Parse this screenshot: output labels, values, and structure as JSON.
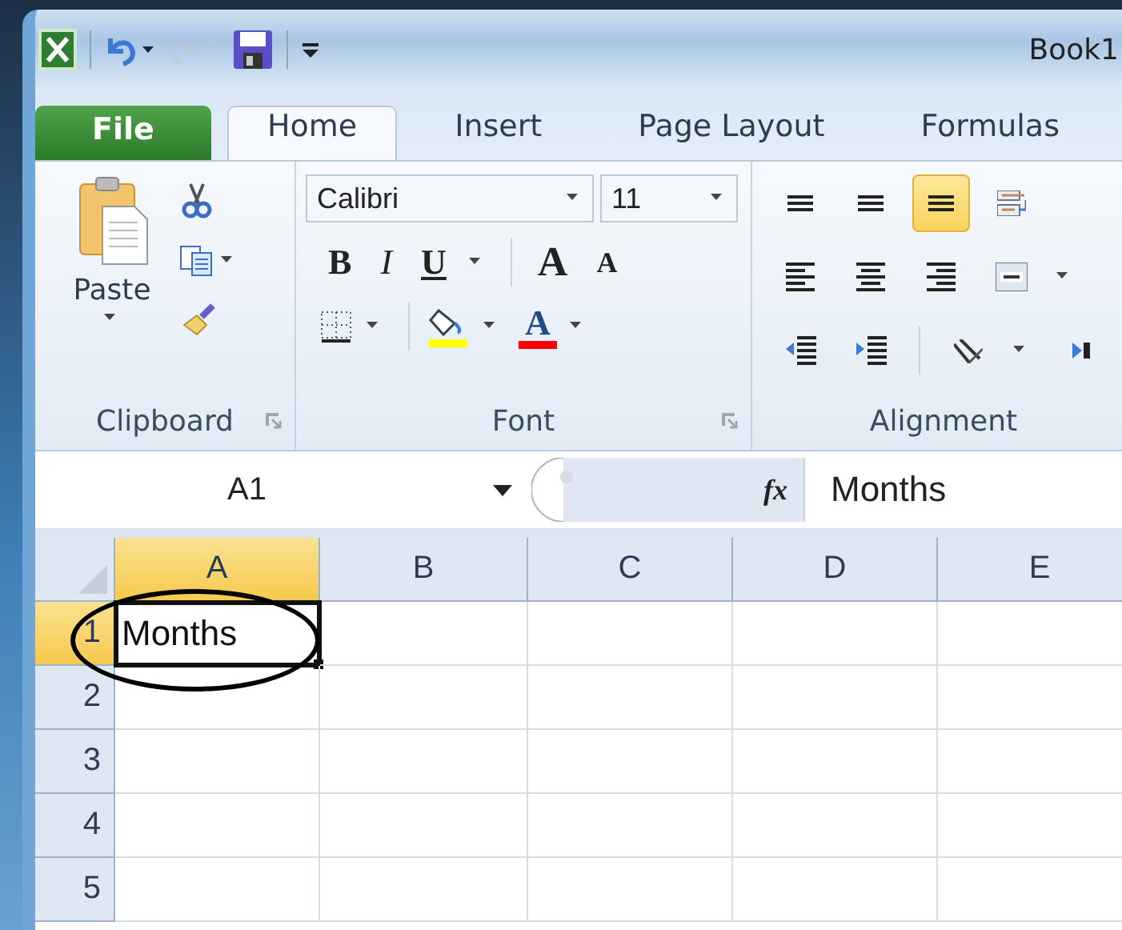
{
  "window": {
    "title": "Book1"
  },
  "quick_access": [
    {
      "kind": "app",
      "disabled": false
    },
    {
      "kind": "undo",
      "disabled": false
    },
    {
      "kind": "redo",
      "disabled": true
    },
    {
      "kind": "save",
      "disabled": false
    },
    {
      "kind": "customize",
      "disabled": false
    }
  ],
  "tabs": [
    {
      "label": "File",
      "kind": "file",
      "selected": false
    },
    {
      "label": "Home",
      "kind": "tab",
      "selected": true
    },
    {
      "label": "Insert",
      "kind": "tab",
      "selected": false
    },
    {
      "label": "Page Layout",
      "kind": "tab",
      "selected": false
    },
    {
      "label": "Formulas",
      "kind": "tab",
      "selected": false
    }
  ],
  "ribbon": {
    "groups": [
      {
        "kind": "clipboard",
        "label": "Clipboard",
        "launcher": true,
        "paste_label": "Paste"
      },
      {
        "kind": "font",
        "label": "Font",
        "launcher": true,
        "font_name": "Calibri",
        "font_size": "11",
        "rows": [
          [
            {
              "kind": "bold",
              "text": "B"
            },
            {
              "kind": "italic",
              "text": "I"
            },
            {
              "kind": "underline",
              "text": "U"
            },
            {
              "kind": "sep"
            },
            {
              "kind": "grow",
              "text": "A"
            },
            {
              "kind": "shrink",
              "text": "A"
            }
          ],
          [
            {
              "kind": "borders"
            },
            {
              "kind": "sep"
            },
            {
              "kind": "fill"
            },
            {
              "kind": "fontcolor",
              "text": "A"
            }
          ]
        ]
      },
      {
        "kind": "alignment",
        "label": "Alignment",
        "launcher": false,
        "rows": [
          [
            {
              "kind": "align-top",
              "selected": false
            },
            {
              "kind": "align-middle",
              "selected": false
            },
            {
              "kind": "align-bottom",
              "selected": true
            },
            {
              "kind": "wrap",
              "selected": false
            }
          ],
          [
            {
              "kind": "align-left",
              "selected": false
            },
            {
              "kind": "align-center",
              "selected": false
            },
            {
              "kind": "align-right",
              "selected": false
            },
            {
              "kind": "merge",
              "selected": false
            }
          ],
          [
            {
              "kind": "outdent",
              "selected": false
            },
            {
              "kind": "indent",
              "selected": false
            },
            {
              "kind": "orientation",
              "selected": false
            },
            {
              "kind": "rtl",
              "selected": false
            }
          ]
        ]
      }
    ]
  },
  "formula_bar": {
    "name_box": "A1",
    "fx": "fx",
    "value": "Months"
  },
  "sheet": {
    "columns": [
      {
        "label": "A",
        "selected": true
      },
      {
        "label": "B",
        "selected": false
      },
      {
        "label": "C",
        "selected": false
      },
      {
        "label": "D",
        "selected": false
      },
      {
        "label": "E",
        "selected": false
      }
    ],
    "rows": [
      {
        "label": "1",
        "selected": true,
        "cells": [
          {
            "text": "Months",
            "active": true,
            "circled": true
          },
          {
            "active": false,
            "circled": false
          },
          {
            "active": false,
            "circled": false
          },
          {
            "active": false,
            "circled": false
          },
          {
            "active": false,
            "circled": false
          }
        ]
      },
      {
        "label": "2",
        "selected": false,
        "cells": [
          {
            "active": false,
            "circled": false
          },
          {
            "active": false,
            "circled": false
          },
          {
            "active": false,
            "circled": false
          },
          {
            "active": false,
            "circled": false
          },
          {
            "active": false,
            "circled": false
          }
        ]
      },
      {
        "label": "3",
        "selected": false,
        "cells": [
          {
            "active": false,
            "circled": false
          },
          {
            "active": false,
            "circled": false
          },
          {
            "active": false,
            "circled": false
          },
          {
            "active": false,
            "circled": false
          },
          {
            "active": false,
            "circled": false
          }
        ]
      },
      {
        "label": "4",
        "selected": false,
        "cells": [
          {
            "active": false,
            "circled": false
          },
          {
            "active": false,
            "circled": false
          },
          {
            "active": false,
            "circled": false
          },
          {
            "active": false,
            "circled": false
          },
          {
            "active": false,
            "circled": false
          }
        ]
      },
      {
        "label": "5",
        "selected": false,
        "cells": [
          {
            "active": false,
            "circled": false
          },
          {
            "active": false,
            "circled": false
          },
          {
            "active": false,
            "circled": false
          },
          {
            "active": false,
            "circled": false
          },
          {
            "active": false,
            "circled": false
          }
        ]
      }
    ]
  }
}
